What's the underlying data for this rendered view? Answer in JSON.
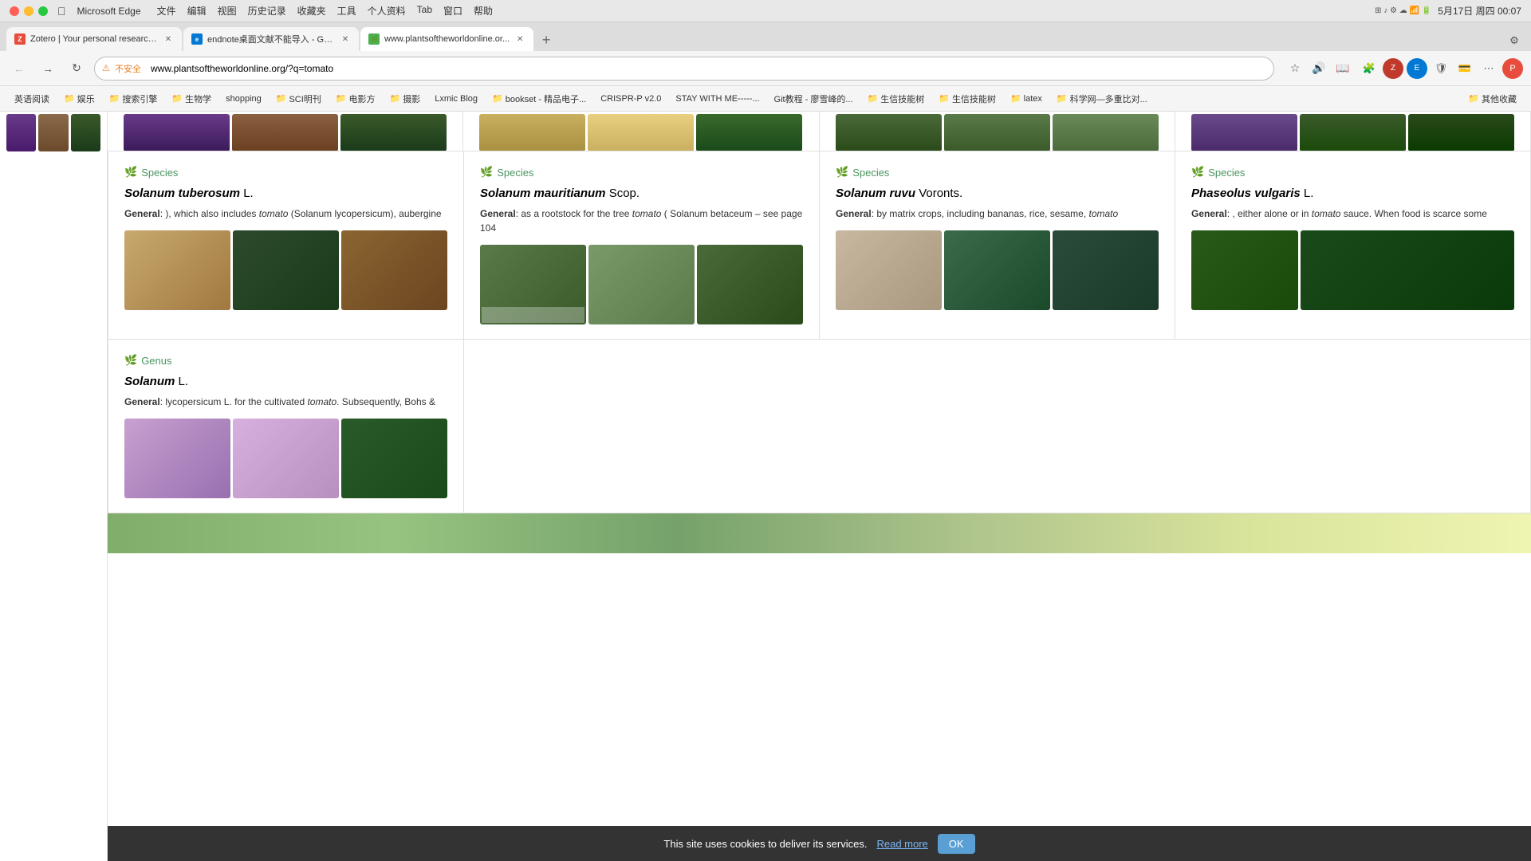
{
  "os": {
    "app_name": "Microsoft Edge",
    "menus": [
      "文件",
      "编辑",
      "视图",
      "历史记录",
      "收藏夹",
      "工具",
      "个人资料",
      "Tab",
      "窗口",
      "帮助"
    ],
    "time": "5月17日 周四 00:07",
    "battery": "100%"
  },
  "browser": {
    "tabs": [
      {
        "id": "tab1",
        "favicon_type": "z",
        "title": "Zotero | Your personal research...",
        "active": false,
        "closeable": true
      },
      {
        "id": "tab2",
        "favicon_type": "e",
        "title": "endnote桌面文献不能导入 - Go...",
        "active": false,
        "closeable": true
      },
      {
        "id": "tab3",
        "favicon_type": "p",
        "title": "www.plantsoftheworldonline.or...",
        "active": true,
        "closeable": true
      }
    ],
    "address": "www.plantsoftheworldonline.org/?q=tomato",
    "security_warning": "不安全",
    "bookmarks": [
      {
        "label": "英语阅读",
        "has_folder": false
      },
      {
        "label": "娱乐",
        "has_folder": true
      },
      {
        "label": "搜索引擎",
        "has_folder": true
      },
      {
        "label": "生物学",
        "has_folder": true
      },
      {
        "label": "shopping",
        "has_folder": false
      },
      {
        "label": "SCI明刊",
        "has_folder": true
      },
      {
        "label": "电影方",
        "has_folder": true
      },
      {
        "label": "摄影",
        "has_folder": true
      },
      {
        "label": "Lxmic Blog",
        "has_folder": false
      },
      {
        "label": "bookset - 精品电子...",
        "has_folder": true
      },
      {
        "label": "CRISPR-P v2.0",
        "has_folder": false
      },
      {
        "label": "STAY WITH ME-----...",
        "has_folder": false
      },
      {
        "label": "Git教程 - 廖雪峰的...",
        "has_folder": false
      },
      {
        "label": "生信技能树",
        "has_folder": true
      },
      {
        "label": "生信技能树",
        "has_folder": true
      },
      {
        "label": "latex",
        "has_folder": true
      },
      {
        "label": "科学网—多重比对...",
        "has_folder": true
      },
      {
        "label": "其他收藏",
        "has_folder": true
      }
    ]
  },
  "webpage": {
    "top_images_visible": true,
    "results": [
      {
        "type": "Species",
        "name_italic": "Solanum tuberosum",
        "name_author": "L.",
        "desc_bold": "General",
        "desc_text": ": ), which also includes tomato (Solanum lycopersicum), aubergine",
        "desc_italic_word": "tomato",
        "images": [
          "potato-brown",
          "herbarium-dark",
          "potato-round"
        ]
      },
      {
        "type": "Species",
        "name_italic": "Solanum mauritianum",
        "name_author": "Scop.",
        "desc_bold": "General",
        "desc_text": ": as a rootstock for the tree tomato ( Solanum betaceum – see page 104",
        "desc_italic_word": "tomato",
        "images": [
          "herbarium-leaf1",
          "herbarium-leaf2",
          "herbarium-leaf3"
        ]
      },
      {
        "type": "Species",
        "name_italic": "Solanum ruvu",
        "name_author": "Voronts.",
        "desc_bold": "General",
        "desc_text": ": by matrix crops, including bananas, rice, sesame, tomato",
        "desc_italic_word": "tomato",
        "images": [
          "bark-texture",
          "forest-scene",
          "plant-stem"
        ]
      },
      {
        "type": "Species",
        "name_italic": "Phaseolus vulgaris",
        "name_author": "L.",
        "desc_bold": "General",
        "desc_text": ": , either alone or in tomato sauce. When food is scarce some",
        "desc_italic_word": "tomato",
        "images": [
          "leaves-green1",
          "leaves-green2"
        ]
      }
    ],
    "genus_result": {
      "type": "Genus",
      "name_italic": "Solanum",
      "name_author": "L.",
      "desc_bold": "General",
      "desc_text": ": lycopersicum L. for the cultivated tomato. Subsequently, Bohs &",
      "desc_italic_word": "tomato",
      "images": [
        "purple-flower",
        "white-flower",
        "green-leaf"
      ]
    },
    "cookie_banner": {
      "text": "This site uses cookies to deliver its services.",
      "read_more_label": "Read more",
      "ok_label": "OK"
    }
  }
}
